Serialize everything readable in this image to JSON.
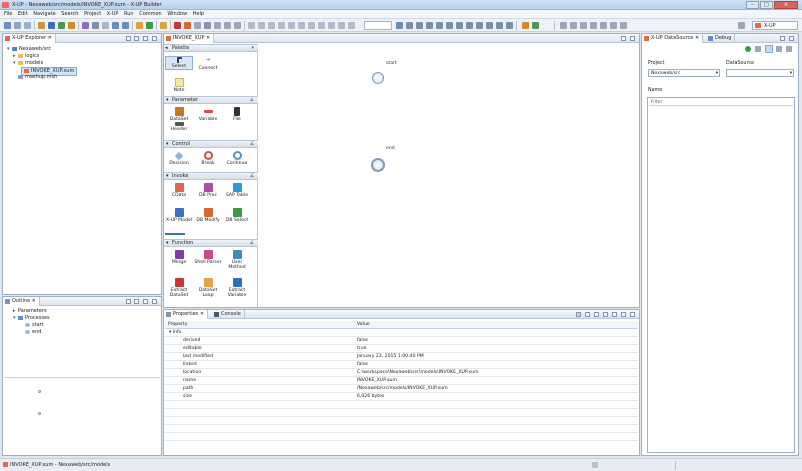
{
  "window": {
    "title": "X-UP - Nexaweb/src/models/INVOKE_XUP.xum - X-UP Builder",
    "minimize": "–",
    "maximize": "□",
    "close": "✕"
  },
  "menu": [
    "File",
    "Edit",
    "Navigate",
    "Search",
    "Project",
    "X-UP",
    "Run",
    "Common",
    "Window",
    "Help"
  ],
  "toolbar": {
    "perspective_label": "X-UP"
  },
  "explorer": {
    "tab": "X-UP Explorer",
    "tree": [
      {
        "label": "Nexaweb/src",
        "depth": 0,
        "toggle": "▾",
        "icon": "project"
      },
      {
        "label": "logics",
        "depth": 1,
        "toggle": "▸",
        "icon": "folder"
      },
      {
        "label": "models",
        "depth": 1,
        "toggle": "▾",
        "icon": "folder"
      },
      {
        "label": "INVOKE_XUP.xum",
        "depth": 2,
        "toggle": "",
        "icon": "model",
        "selected": true
      },
      {
        "label": "mashup.msh",
        "depth": 1,
        "toggle": "",
        "icon": "file"
      }
    ]
  },
  "outline": {
    "tab": "Outline",
    "tree": [
      {
        "label": "Parameters",
        "depth": 0,
        "toggle": "▸"
      },
      {
        "label": "Processes",
        "depth": 0,
        "toggle": "▾"
      },
      {
        "label": "start",
        "depth": 1,
        "toggle": ""
      },
      {
        "label": "end",
        "depth": 1,
        "toggle": ""
      }
    ]
  },
  "editor": {
    "tab": "INVOKE_XUP",
    "palette": {
      "title": "Palette",
      "tools": [
        {
          "label": "Select",
          "color": "#d8e6f5"
        },
        {
          "label": "Connect",
          "color": "#ffffff"
        },
        {
          "label": "Note",
          "color": "#f4e8a8"
        }
      ],
      "sections": [
        {
          "title": "Parameter",
          "items": [
            {
              "label": "DataSet",
              "color": "#c7781e"
            },
            {
              "label": "Variable",
              "color": "#e04a4a"
            },
            {
              "label": "File",
              "color": "#333333"
            },
            {
              "label": "Header",
              "color": "#555555"
            }
          ]
        },
        {
          "title": "Control",
          "items": [
            {
              "label": "Decision",
              "color": "#8fb3d9"
            },
            {
              "label": "Break",
              "color": "#d94a4a"
            },
            {
              "label": "Continue",
              "color": "#5b8fd1"
            }
          ]
        },
        {
          "title": "Invoke",
          "items": [
            {
              "label": "CData",
              "color": "#e2654e"
            },
            {
              "label": "DB Proc",
              "color": "#b44aa8"
            },
            {
              "label": "SAP Table",
              "color": "#2d9ad8"
            },
            {
              "label": "X-UP Model",
              "color": "#3c6fbf"
            },
            {
              "label": "DB Modify",
              "color": "#d86a2b"
            },
            {
              "label": "DB Select",
              "color": "#3d9a4a"
            }
          ]
        },
        {
          "title": "Function",
          "items": [
            {
              "label": "Merge",
              "color": "#7c3fa3"
            },
            {
              "label": "Shell Parser",
              "color": "#c84a8a"
            },
            {
              "label": "User Method",
              "color": "#3d8fb8"
            },
            {
              "label": "Extract DataSet",
              "color": "#c83838"
            },
            {
              "label": "DataSet Loop",
              "color": "#e5a24a"
            },
            {
              "label": "Extract Variable",
              "color": "#2d6fbf"
            }
          ]
        }
      ]
    },
    "nodes": [
      {
        "label": "start"
      },
      {
        "label": "end"
      }
    ]
  },
  "properties": {
    "tab": "Properties",
    "console_tab": "Console",
    "header": {
      "property": "Property",
      "value": "Value"
    },
    "group": "Info",
    "rows": [
      {
        "key": "derived",
        "value": "false"
      },
      {
        "key": "editable",
        "value": "true"
      },
      {
        "key": "last modified",
        "value": "January 23, 2015 1:00:40 PM"
      },
      {
        "key": "linked",
        "value": "false"
      },
      {
        "key": "location",
        "value": "C:\\workspace\\Nexaweb\\src\\models\\INVOKE_XUP.xum"
      },
      {
        "key": "name",
        "value": "INVOKE_XUP.xum"
      },
      {
        "key": "path",
        "value": "/Nexaweb/src/models/INVOKE_XUP.xum"
      },
      {
        "key": "size",
        "value": "6,026 bytes"
      }
    ]
  },
  "datasource": {
    "tab": "X-UP DataSource",
    "debug_tab": "Debug",
    "project_label": "Project",
    "project_value": "Nexaweb/src",
    "datasource_label": "DataSource",
    "datasource_value": "",
    "name_label": "Name",
    "filter_placeholder": "Filter"
  },
  "status": {
    "text": "INVOKE_XUP.xum - Nexaweb/src/models"
  }
}
